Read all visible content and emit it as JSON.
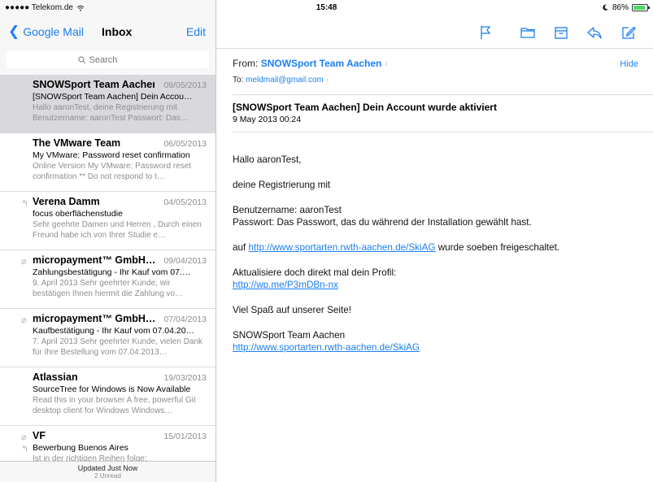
{
  "status_bar": {
    "carrier": "●●●●● Telekom.de",
    "time": "15:48",
    "battery": "86%",
    "battery_level": 0.86
  },
  "sidebar": {
    "back_label": "Google Mail",
    "title": "Inbox",
    "edit_label": "Edit",
    "search_placeholder": "Search",
    "messages": [
      {
        "sender": "SNOWSport Team Aachen",
        "date": "09/05/2013",
        "subject": "[SNOWSport Team Aachen] Dein Accou…",
        "preview": "Hallo aaronTest, deine Registrierung mit Benutzername: aaronTest Passwort: Das…"
      },
      {
        "sender": "The VMware Team",
        "date": "06/05/2013",
        "subject": "My VMware: Password reset confirmation",
        "preview": "Online Version My VMware: Password reset confirmation ** Do not respond to t…"
      },
      {
        "sender": "Verena Damm",
        "date": "04/05/2013",
        "subject": "focus oberflächenstudie",
        "preview": "Sehr geehrte Damen und Herren , Durch einen Freund habe ich von Ihrer Studie e…"
      },
      {
        "sender": "micropayment™ GmbH…",
        "date": "09/04/2013",
        "subject": "Zahlungsbestätigung - Ihr Kauf vom 07.…",
        "preview": "9. April 2013 Sehr geehrter Kunde, wir bestätigen Ihnen hiermit die Zahlung vo…"
      },
      {
        "sender": "micropayment™ GmbH…",
        "date": "07/04/2013",
        "subject": "Kaufbestätigung - Ihr Kauf vom 07.04.20…",
        "preview": "7. April 2013 Sehr geehrter Kunde, vielen Dank für Ihre Bestellung vom 07.04.2013…"
      },
      {
        "sender": "Atlassian",
        "date": "19/03/2013",
        "subject": "SourceTree for Windows is Now Available",
        "preview": "Read this in your browser A free, powerful Git desktop client for Windows Windows…"
      },
      {
        "sender": "VF",
        "date": "15/01/2013",
        "subject": "Bewerbung Buenos Aires",
        "preview": "Ist in der richtigen Reihen folge:"
      }
    ],
    "footer_updated": "Updated Just Now",
    "footer_unread": "2 Unread"
  },
  "detail": {
    "from_label": "From:",
    "from_name": "SNOWSport Team Aachen",
    "hide_label": "Hide",
    "to_label": "To:",
    "to_addr": "meldmail@gmail.com",
    "subject": "[SNOWSport Team Aachen] Dein Account wurde aktiviert",
    "date": "9 May 2013 00:24",
    "body": {
      "greeting": "Hallo aaronTest,",
      "line1": "deine Registrierung mit",
      "username": "Benutzername: aaronTest",
      "password": "Passwort: Das Passwort, das du während der Installation gewählt hast.",
      "prefix_auf": "auf",
      "link1": "http://www.sportarten.rwth-aachen.de/SkiAG",
      "activated": "wurde soeben freigeschaltet.",
      "update_profile": "Aktualisiere doch direkt mal dein Profil:",
      "link2": "http://wp.me/P3mDBn-nx",
      "fun": "Viel Spaß auf unserer Seite!",
      "signature": "SNOWSport Team Aachen",
      "link3": "http://www.sportarten.rwth-aachen.de/SkiAG"
    }
  },
  "colors": {
    "accent": "#1a7ff5",
    "selected_row": "#d9d9dd",
    "battery": "#4cd964"
  }
}
